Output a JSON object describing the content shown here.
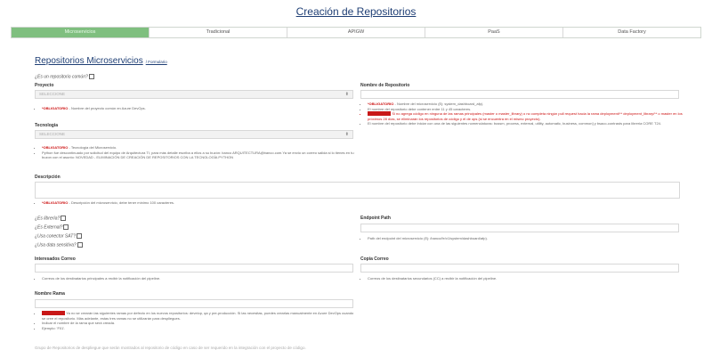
{
  "page": {
    "title": "Creación de Repositorios"
  },
  "tabs": [
    "Microservicios",
    "Tradicional",
    "APIGW",
    "PaaS",
    "Data Factory"
  ],
  "section": {
    "title": "Repositorios Microservicios",
    "subtitle": "/ Formulario"
  },
  "left": {
    "es_comun_label": "¿Es un repositorio común?",
    "proyecto": {
      "label": "Proyecto",
      "placeholder": "SELECCIONE",
      "help_tag": "*OBLIGATORIO",
      "help": " - Nombre del proyecto común en Azure DevOps."
    },
    "tecnologia": {
      "label": "Tecnologia",
      "placeholder": "SELECCIONE",
      "help_tag": "*OBLIGATORIO",
      "help": " - Tecnología del Microservicio.",
      "help2": "Python fue descontinuado por solicitud del equipo de Arquitectura TI, para más detalle escriba a ellos a su buzón: banco ARQUITECTURA@banco.com.Ya se envio un correo salida si lo tienes en tu buzon con el asunto: NOVEDAD - ELIMINACIÓN DE CREACIÓN DE REPOSITORIOS CON LA TECNOLOGÍA PYTHON"
    },
    "checks": [
      "¿Es librería?",
      "¿Es External?",
      "¿Usa conector SAT?",
      "¿Usa data sensitiva?"
    ],
    "interesados": {
      "label": "Interesados Correo",
      "help": "Correos de los destinatarios principales a recibir la notificación del pipeline."
    },
    "rama": {
      "label": "Nombre Rama",
      "help1_tag": "Importante:",
      "help1": " Ya no se crearán las siguientes ramas por defecto en los nuevos repositorios: develop, qa y pre-producción. Si las necesitas, puedes crearlas manualmente en Azure DevOps cuando se cree el repositorio. Más adelante, estas tres ramas no se utilizarán para despliegues.",
      "help2": "Indicar el nombre de la rama que será creada.",
      "help3": "Ejemplo: 'F01'."
    }
  },
  "right": {
    "nombre": {
      "label": "Nombre de Repositorio",
      "help_tag": "*OBLIGATORIO",
      "help": " - Nombre del microservicio (Ej: system_dashboard_afp).",
      "help2": "El nombre del repositorio debe contener entre 11 y 45 caracteres.",
      "warn_tag": "Importante:",
      "warn": " Si no agrega código en ninguna de las ramas principales (master o master_library) o no completa ningún pull request hacia la rama deployment/** deployment_library/** o master en los próximos 28 días, se eliminarán los repositorios de código y el de ops (si se encuentra en el mismo proyecto).",
      "help3": "El nombre del repositorio debe iniciar con una de las siguientes nomenclaturas: bussm, process, external, utility, automatic, business, common] y bsaco-contrasts para libreria CORE T24."
    },
    "endpoint": {
      "label": "Endpoint Path",
      "help": "Path del endpoint del microservicio (Ej: /banco/fe/v1/system/dashboard/afp)."
    },
    "copia": {
      "label": "Copia Correo",
      "help": "Correos de los destinatarios secundarios (CC) a recibir la notificación del pipeline."
    }
  },
  "descripcion": {
    "label": "Descripción",
    "help_tag": "*OBLIGATORIO",
    "help": " - Descripción del microservicio, debe tener mínimo 100 caracteres."
  },
  "footer": {
    "text": "Grupo de Repositorios de despliegue que serán mostrados al repositorio de código en caso de ser requerido en la integración con el proyecto de código."
  }
}
